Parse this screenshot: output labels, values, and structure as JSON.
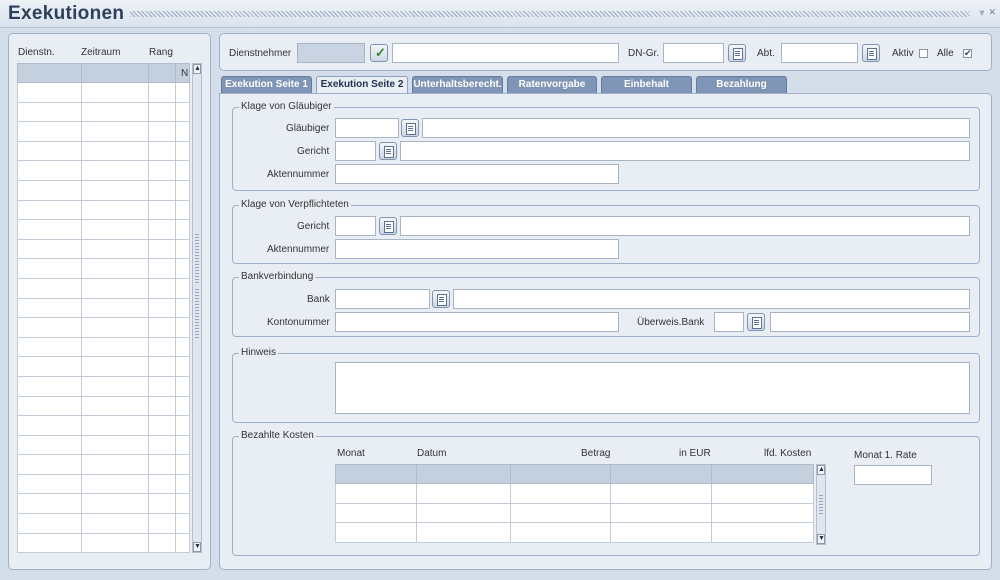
{
  "window": {
    "title": "Exekutionen",
    "controls": [
      "⩔",
      "✕"
    ]
  },
  "left_list": {
    "headers": [
      "Dienstn.",
      "Zeitraum",
      "Rang"
    ],
    "sub_header": "N",
    "rows": 24
  },
  "header": {
    "dienstnehmer_label": "Dienstnehmer",
    "dienstnehmer_value": "",
    "dienstnehmer_name": "",
    "dngr_label": "DN-Gr.",
    "dngr_value": "",
    "abt_label": "Abt.",
    "abt_value": "",
    "aktiv_label": "Aktiv",
    "aktiv_checked": false,
    "alle_label": "Alle",
    "alle_checked": true
  },
  "tabs": [
    {
      "label": "Exekution Seite 1",
      "active": false
    },
    {
      "label": "Exekution Seite 2",
      "active": true
    },
    {
      "label": "Unterhaltsberecht.",
      "active": false
    },
    {
      "label": "Ratenvorgabe",
      "active": false
    },
    {
      "label": "Einbehalt",
      "active": false
    },
    {
      "label": "Bezahlung",
      "active": false
    }
  ],
  "klage_glaeubiger": {
    "title": "Klage von Gläubiger",
    "glaeubiger_label": "Gläubiger",
    "gericht_label": "Gericht",
    "aktennummer_label": "Aktennummer"
  },
  "klage_verpflichteten": {
    "title": "Klage von Verpflichteten",
    "gericht_label": "Gericht",
    "aktennummer_label": "Aktennummer"
  },
  "bank": {
    "title": "Bankverbindung",
    "bank_label": "Bank",
    "kontonummer_label": "Kontonummer",
    "ueberweis_label": "Überweis.Bank"
  },
  "hinweis": {
    "title": "Hinweis",
    "value": ""
  },
  "kosten": {
    "title": "Bezahlte Kosten",
    "columns": [
      "Monat",
      "Datum",
      "Betrag",
      "in EUR",
      "lfd. Kosten"
    ],
    "rows": 3,
    "monat_rate_label": "Monat 1. Rate",
    "monat_rate_value": ""
  }
}
